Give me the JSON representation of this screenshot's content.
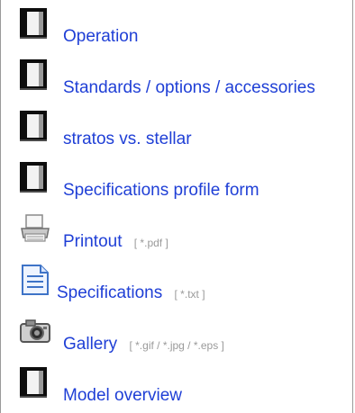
{
  "menu": {
    "items": [
      {
        "label": "Operation",
        "ext": "",
        "icon": "document-icon"
      },
      {
        "label": "Standards / options / accessories",
        "ext": "",
        "icon": "document-icon"
      },
      {
        "label": "stratos vs. stellar",
        "ext": "",
        "icon": "document-icon"
      },
      {
        "label": "Specifications profile form",
        "ext": "",
        "icon": "document-icon"
      },
      {
        "label": "Printout",
        "ext": "[ *.pdf ]",
        "icon": "printer-icon"
      },
      {
        "label": "Specifications",
        "ext": "[ *.txt ]",
        "icon": "text-file-icon"
      },
      {
        "label": "Gallery",
        "ext": "[ *.gif / *.jpg / *.eps ]",
        "icon": "camera-icon"
      },
      {
        "label": "Model overview",
        "ext": "",
        "icon": "document-icon"
      }
    ]
  },
  "colors": {
    "link": "#1f3fd6",
    "ext": "#9a9a9a",
    "icon_dark": "#0d0d0d",
    "icon_light": "#f2f2f2"
  }
}
